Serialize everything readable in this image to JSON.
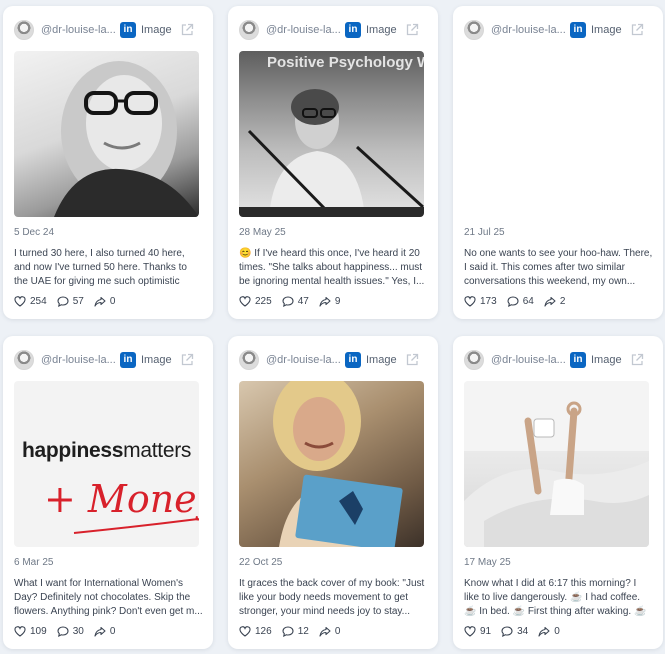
{
  "colors": {
    "page_bg": "#edf1f6",
    "card_bg": "#ffffff",
    "linkedin_blue": "#0a66c2",
    "text": "#3b4452",
    "muted": "#6f7987"
  },
  "icons": {
    "platform": "linkedin-icon",
    "external": "external-link-icon",
    "likes": "heart-icon",
    "comments": "comment-icon",
    "shares": "share-icon"
  },
  "posts": [
    {
      "author_handle": "@dr-louise-la...",
      "platform_badge": "in",
      "media_type": "Image",
      "date": "5 Dec 24",
      "text": "I turned 30 here, I also turned 40 here, and now I've turned 50 here. Thanks to the UAE for giving me such optimistic wings, so...",
      "likes": "254",
      "comments": "57",
      "shares": "0"
    },
    {
      "author_handle": "@dr-louise-la...",
      "platform_badge": "in",
      "media_type": "Image",
      "media_text": "Positive Psychology W",
      "date": "28 May 25",
      "text": "😊 If I've heard this once, I've heard it 20 times. \"She talks about happiness... must be ignoring mental health issues.\" Yes, I...",
      "likes": "225",
      "comments": "47",
      "shares": "9"
    },
    {
      "author_handle": "@dr-louise-la...",
      "platform_badge": "in",
      "media_type": "Image",
      "date": "21 Jul 25",
      "text": "No one wants to see your hoo-haw. There, I said it. This comes after two similar conversations this weekend, my own...",
      "likes": "173",
      "comments": "64",
      "shares": "2"
    },
    {
      "author_handle": "@dr-louise-la...",
      "platform_badge": "in",
      "media_type": "Image",
      "media_text_bold": "happiness",
      "media_text_regular": "matters",
      "media_text_money": "+ Money",
      "date": "6 Mar 25",
      "text": "What I want for International Women's Day? Definitely not chocolates. Skip the flowers. Anything pink? Don't even get m...",
      "likes": "109",
      "comments": "30",
      "shares": "0"
    },
    {
      "author_handle": "@dr-louise-la...",
      "platform_badge": "in",
      "media_type": "Image",
      "date": "22 Oct 25",
      "text": "It graces the back cover of my book: \"Just like your body needs movement to get stronger, your mind needs joy to stay...",
      "likes": "126",
      "comments": "12",
      "shares": "0"
    },
    {
      "author_handle": "@dr-louise-la...",
      "platform_badge": "in",
      "media_type": "Image",
      "date": "17 May 25",
      "text": "Know what I did at 6:17 this morning? I like to live dangerously. ☕ I had coffee. ☕ In bed. ☕ First thing after waking. ☕ While...",
      "likes": "91",
      "comments": "34",
      "shares": "0"
    }
  ]
}
